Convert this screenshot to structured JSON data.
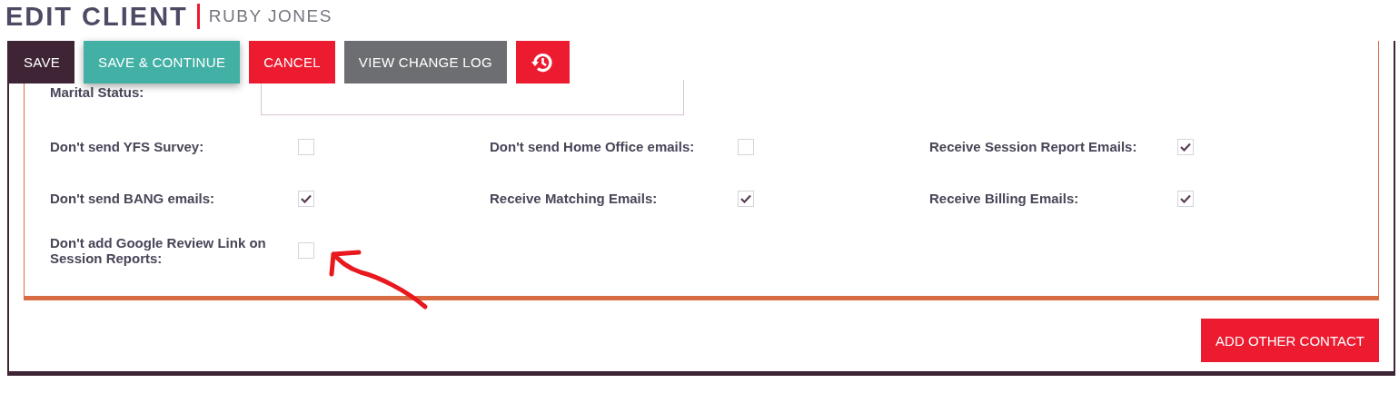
{
  "header": {
    "title": "EDIT CLIENT",
    "subtitle": "RUBY JONES"
  },
  "toolbar": [
    {
      "kind": "dark",
      "label": "SAVE"
    },
    {
      "kind": "teal",
      "label": "SAVE & CONTINUE"
    },
    {
      "kind": "red",
      "label": "CANCEL"
    },
    {
      "kind": "grey",
      "label": "VIEW CHANGE LOG"
    },
    {
      "kind": "history"
    }
  ],
  "form": {
    "marital_status": {
      "label": "Marital Status:"
    },
    "checkboxes": [
      {
        "label": "Don't send YFS Survey:",
        "checked": false
      },
      {
        "label": "Don't send Home Office emails:",
        "checked": false
      },
      {
        "label": "Receive Session Report Emails:",
        "checked": true
      },
      {
        "label": "Don't send BANG emails:",
        "checked": true
      },
      {
        "label": "Receive Matching Emails:",
        "checked": true
      },
      {
        "label": "Receive Billing Emails:",
        "checked": true
      },
      {
        "label": "Don't add Google Review Link on Session Reports:",
        "checked": false
      }
    ]
  },
  "actions": [
    {
      "label": "ADD OTHER CONTACT"
    }
  ]
}
